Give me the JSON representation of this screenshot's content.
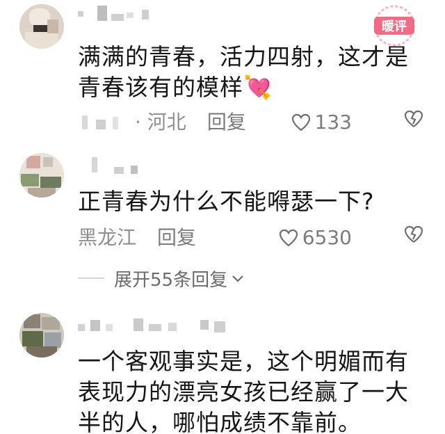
{
  "watermark": {
    "text": "暖评",
    "color": "#f05b7a"
  },
  "comments": [
    {
      "text": "满满的青春，活力四射，这才是青春该有的模样",
      "emoji": "💘",
      "location": "· 河北",
      "reply_label": "回复",
      "likes": "133"
    },
    {
      "text": "正青春为什么不能嘚瑟一下?",
      "location": "黑龙江",
      "reply_label": "回复",
      "likes": "6530",
      "expand_label": "展开55条回复"
    },
    {
      "text": "一个客观事实是，这个明媚而有表现力的漂亮女孩已经赢了一大半的人，哪怕成绩不靠前。"
    }
  ],
  "icons": {
    "like": "heart-outline-icon",
    "dislike": "broken-heart-icon",
    "expand": "chevron-down-icon"
  },
  "colors": {
    "text": "#161616",
    "meta": "#8f8f8f",
    "accent": "#f05b7a"
  }
}
